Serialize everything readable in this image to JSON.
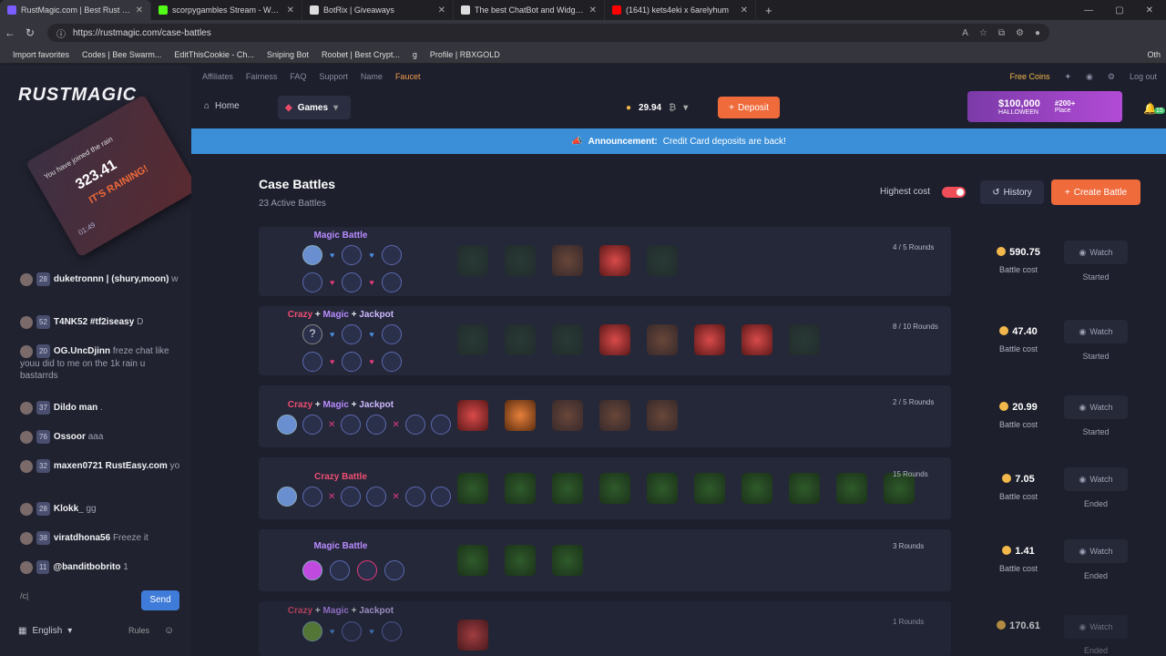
{
  "browser": {
    "tabs": [
      {
        "title": "RustMagic.com | Best Rust Case B",
        "color": "#7b5cff",
        "active": true
      },
      {
        "title": "scorpygambles Stream - Watch Li",
        "color": "#53fc18",
        "active": false
      },
      {
        "title": "BotRix | Giveaways",
        "color": "#dddddd",
        "active": false
      },
      {
        "title": "The best ChatBot and Widgets fo",
        "color": "#dddddd",
        "active": false
      },
      {
        "title": "(1641) kets4eki x 6arelyhum",
        "color": "#ff0000",
        "active": false
      }
    ],
    "url": "https://rustmagic.com/case-battles",
    "bookmarks": [
      "Import favorites",
      "Codes | Bee Swarm...",
      "EditThisCookie - Ch...",
      "Sniping Bot",
      "Roobet | Best Crypt...",
      "g",
      "Profile | RBXGOLD",
      "Oth"
    ]
  },
  "sidebar": {
    "logo": "RUSTMAGIC",
    "rain": {
      "joined": "You have joined the rain",
      "amount": "323.41",
      "raining": "IT'S RAINING!",
      "timer": "01:49"
    },
    "chat": [
      {
        "level": "28",
        "user": "duketronnn | (shury,moon)",
        "text": "w"
      },
      {
        "level": "52",
        "user": "T4NK52 #tf2iseasy",
        "text": "D"
      },
      {
        "level": "20",
        "user": "OG.UncDjinn",
        "text": "freze chat like youu did to me on the 1k rain u bastarrds"
      },
      {
        "level": "37",
        "user": "Dildo man",
        "text": "."
      },
      {
        "level": "76",
        "user": "Ossoor",
        "text": "aaa"
      },
      {
        "level": "32",
        "user": "maxen0721 RustEasy.com",
        "text": "yo"
      },
      {
        "level": "28",
        "user": "Klokk_",
        "text": "gg"
      },
      {
        "level": "38",
        "user": "viratdhona56",
        "text": "Freeze it"
      },
      {
        "level": "11",
        "user": "@banditbobrito",
        "text": "1"
      }
    ],
    "input_value": "/c|",
    "send_label": "Send",
    "language": "English",
    "rules": "Rules"
  },
  "topnav": {
    "links": [
      "Affiliates",
      "Fairness",
      "FAQ",
      "Support",
      "Name",
      "Faucet"
    ],
    "free_coins": "Free Coins",
    "logout": "Log out"
  },
  "header": {
    "home": "Home",
    "games": "Games",
    "balance": "29.94",
    "deposit": "Deposit",
    "promo_amount": "$100,000",
    "promo_sub": "HALLOWEEN",
    "promo_place": "#200+",
    "promo_place_label": "Place",
    "notif_count": "15"
  },
  "announcement": {
    "label": "Announcement:",
    "text": "Credit Card deposits are back!"
  },
  "page": {
    "title": "Case Battles",
    "active": "23 Active Battles",
    "sort_label": "Highest cost",
    "history": "History",
    "create": "Create Battle"
  },
  "battles": [
    {
      "mode": [
        "Magic Battle"
      ],
      "rounds": "4 / 5 Rounds",
      "cost": "590.75",
      "cost_label": "Battle cost",
      "watch": "Watch",
      "status": "Started"
    },
    {
      "mode": [
        "Crazy",
        "Magic",
        "Jackpot"
      ],
      "rounds": "8 / 10 Rounds",
      "cost": "47.40",
      "cost_label": "Battle cost",
      "watch": "Watch",
      "status": "Started"
    },
    {
      "mode": [
        "Crazy",
        "Magic",
        "Jackpot"
      ],
      "rounds": "2 / 5 Rounds",
      "cost": "20.99",
      "cost_label": "Battle cost",
      "watch": "Watch",
      "status": "Started"
    },
    {
      "mode": [
        "Crazy Battle"
      ],
      "rounds": "15 Rounds",
      "cost": "7.05",
      "cost_label": "Battle cost",
      "watch": "Watch",
      "status": "Ended"
    },
    {
      "mode": [
        "Magic Battle"
      ],
      "rounds": "3 Rounds",
      "cost": "1.41",
      "cost_label": "Battle cost",
      "watch": "Watch",
      "status": "Ended"
    },
    {
      "mode": [
        "Crazy",
        "Magic",
        "Jackpot"
      ],
      "rounds": "1 Rounds",
      "cost": "170.61",
      "cost_label": "",
      "watch": "Watch",
      "status": "Ended"
    }
  ]
}
